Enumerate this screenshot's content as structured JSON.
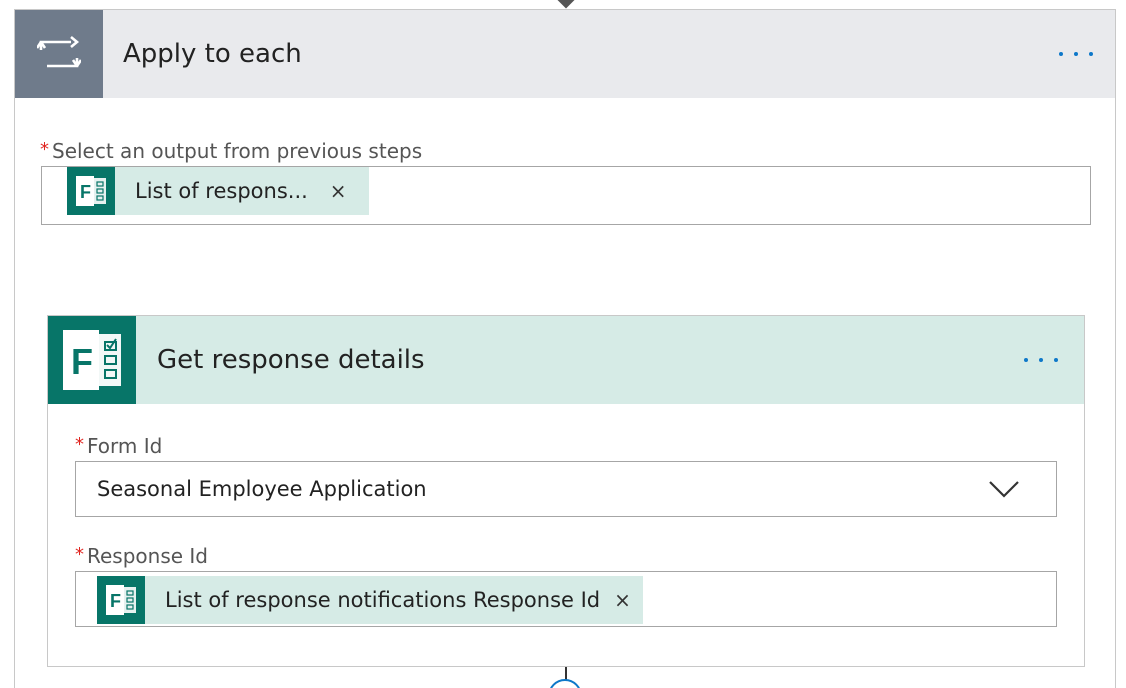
{
  "loop": {
    "title": "Apply to each",
    "select_label": "Select an output from previous steps",
    "token_text": "List of respons...",
    "token_close": "×",
    "icon": "loop-arrows-icon",
    "more_icon": "more-ellipsis-icon"
  },
  "action": {
    "title": "Get response details",
    "icon": "microsoft-forms-icon",
    "form_id": {
      "label": "Form Id",
      "value": "Seasonal Employee Application"
    },
    "response_id": {
      "label": "Response Id",
      "token_text": "List of response notifications Response Id",
      "token_close": "×"
    }
  },
  "required_marker": "*",
  "colors": {
    "loop_header_bg": "#e9eaed",
    "loop_icon_bg": "#6f7b8b",
    "forms_green": "#077568",
    "forms_header_bg": "#d6ebe6",
    "accent_blue": "#0e78c9",
    "required_red": "#e0241f"
  }
}
